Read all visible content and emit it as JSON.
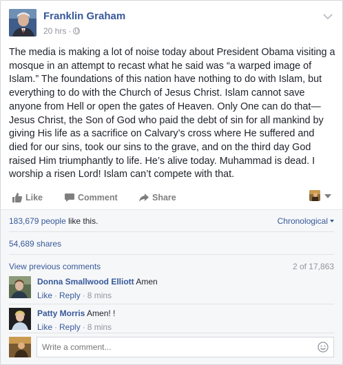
{
  "post": {
    "author": "Franklin Graham",
    "time": "20 hrs",
    "audience_icon": "globe-icon",
    "text": "The media is making a lot of noise today about President Obama visiting a mosque in an attempt to recast what he said was “a warped image of Islam.” The foundations of this nation have nothing to do with Islam, but everything to do with the Church of Jesus Christ. Islam cannot save anyone from Hell or open the gates of Heaven. Only One can do that—Jesus Christ, the Son of God who paid the debt of sin for all mankind by giving His life as a sacrifice on Calvary’s cross where He suffered and died for our sins, took our sins to the grave, and on the third day God raised Him triumphantly to life. He’s alive today. Muhammad is dead. I worship a risen Lord! Islam can’t compete with that."
  },
  "actions": {
    "like": "Like",
    "comment": "Comment",
    "share": "Share"
  },
  "stats": {
    "likes_count": "183,679 people",
    "likes_suffix": " like this.",
    "sort": "Chronological",
    "shares": "54,689 shares"
  },
  "comments_bar": {
    "view_previous": "View previous comments",
    "counter": "2 of 17,863"
  },
  "comments": [
    {
      "name": "Donna Smallwood Elliott",
      "text": "Amen",
      "like": "Like",
      "reply": "Reply",
      "time": "8 mins"
    },
    {
      "name": "Patty Morris",
      "text": "Amen! !",
      "like": "Like",
      "reply": "Reply",
      "time": "8 mins"
    }
  ],
  "composer": {
    "placeholder": "Write a comment..."
  },
  "colors": {
    "link": "#365899",
    "muted": "#90949c",
    "text": "#1d2129"
  }
}
